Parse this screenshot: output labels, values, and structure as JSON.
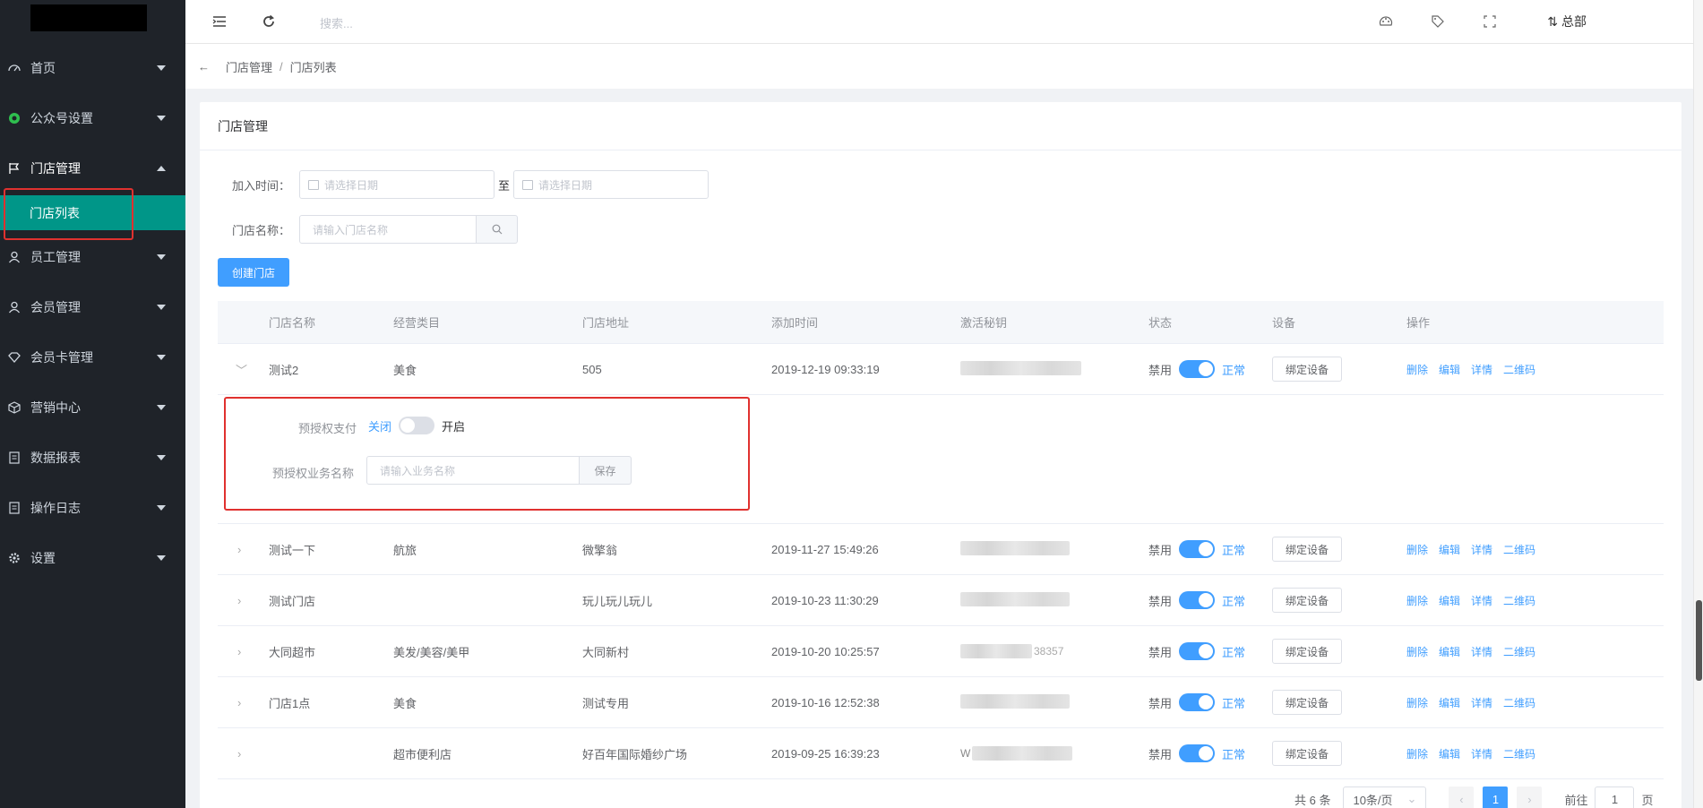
{
  "header": {
    "search_placeholder": "搜索...",
    "user": "总部"
  },
  "sidebar": {
    "items": [
      {
        "label": "首页"
      },
      {
        "label": "公众号设置"
      },
      {
        "label": "门店管理"
      },
      {
        "label": "员工管理"
      },
      {
        "label": "会员管理"
      },
      {
        "label": "会员卡管理"
      },
      {
        "label": "营销中心"
      },
      {
        "label": "数据报表"
      },
      {
        "label": "操作日志"
      },
      {
        "label": "设置"
      }
    ],
    "submenu_active": "门店列表"
  },
  "breadcrumb": [
    "门店管理",
    "门店列表"
  ],
  "card": {
    "title": "门店管理",
    "filters": {
      "join_time_label": "加入时间：",
      "date_placeholder": "请选择日期",
      "to": "至",
      "store_name_label": "门店名称：",
      "store_name_placeholder": "请输入门店名称"
    },
    "create_button": "创建门店"
  },
  "table": {
    "headers": [
      "门店名称",
      "经营类目",
      "门店地址",
      "添加时间",
      "激活秘钥",
      "状态",
      "设备",
      "操作"
    ],
    "status_off": "禁用",
    "status_on": "正常",
    "bind_device": "绑定设备",
    "ops": [
      "删除",
      "编辑",
      "详情",
      "二维码"
    ],
    "rows": [
      {
        "name": "测试2",
        "category": "美食",
        "address": "505",
        "time": "2019-12-19 09:33:19",
        "key": ""
      },
      {
        "name": "测试一下",
        "category": "航旅",
        "address": "微擎翁",
        "time": "2019-11-27 15:49:26",
        "key": ""
      },
      {
        "name": "测试门店",
        "category": "",
        "address": "玩儿玩儿玩儿",
        "time": "2019-10-23 11:30:29",
        "key": ""
      },
      {
        "name": "大同超市",
        "category": "美发/美容/美甲",
        "address": "大同新村",
        "time": "2019-10-20 10:25:57",
        "key": "38357"
      },
      {
        "name": "门店1点",
        "category": "美食",
        "address": "测试专用",
        "time": "2019-10-16 12:52:38",
        "key": ""
      },
      {
        "name": "",
        "category": "超市便利店",
        "address": "好百年国际婚纱广场",
        "time": "2019-09-25 16:39:23",
        "key": "W"
      }
    ],
    "expand": {
      "preauth_label": "预授权支付",
      "off": "关闭",
      "on": "开启",
      "biz_name_label": "预授权业务名称",
      "biz_name_placeholder": "请输入业务名称",
      "save": "保存"
    }
  },
  "pagination": {
    "total": "共 6 条",
    "page_size": "10条/页",
    "current": "1",
    "goto": "前往",
    "goto_value": "1",
    "page_suffix": "页"
  },
  "colors": {
    "sidebar_bg": "#1f2329",
    "active": "#009688",
    "primary": "#409eff",
    "highlight": "#e0312f"
  }
}
